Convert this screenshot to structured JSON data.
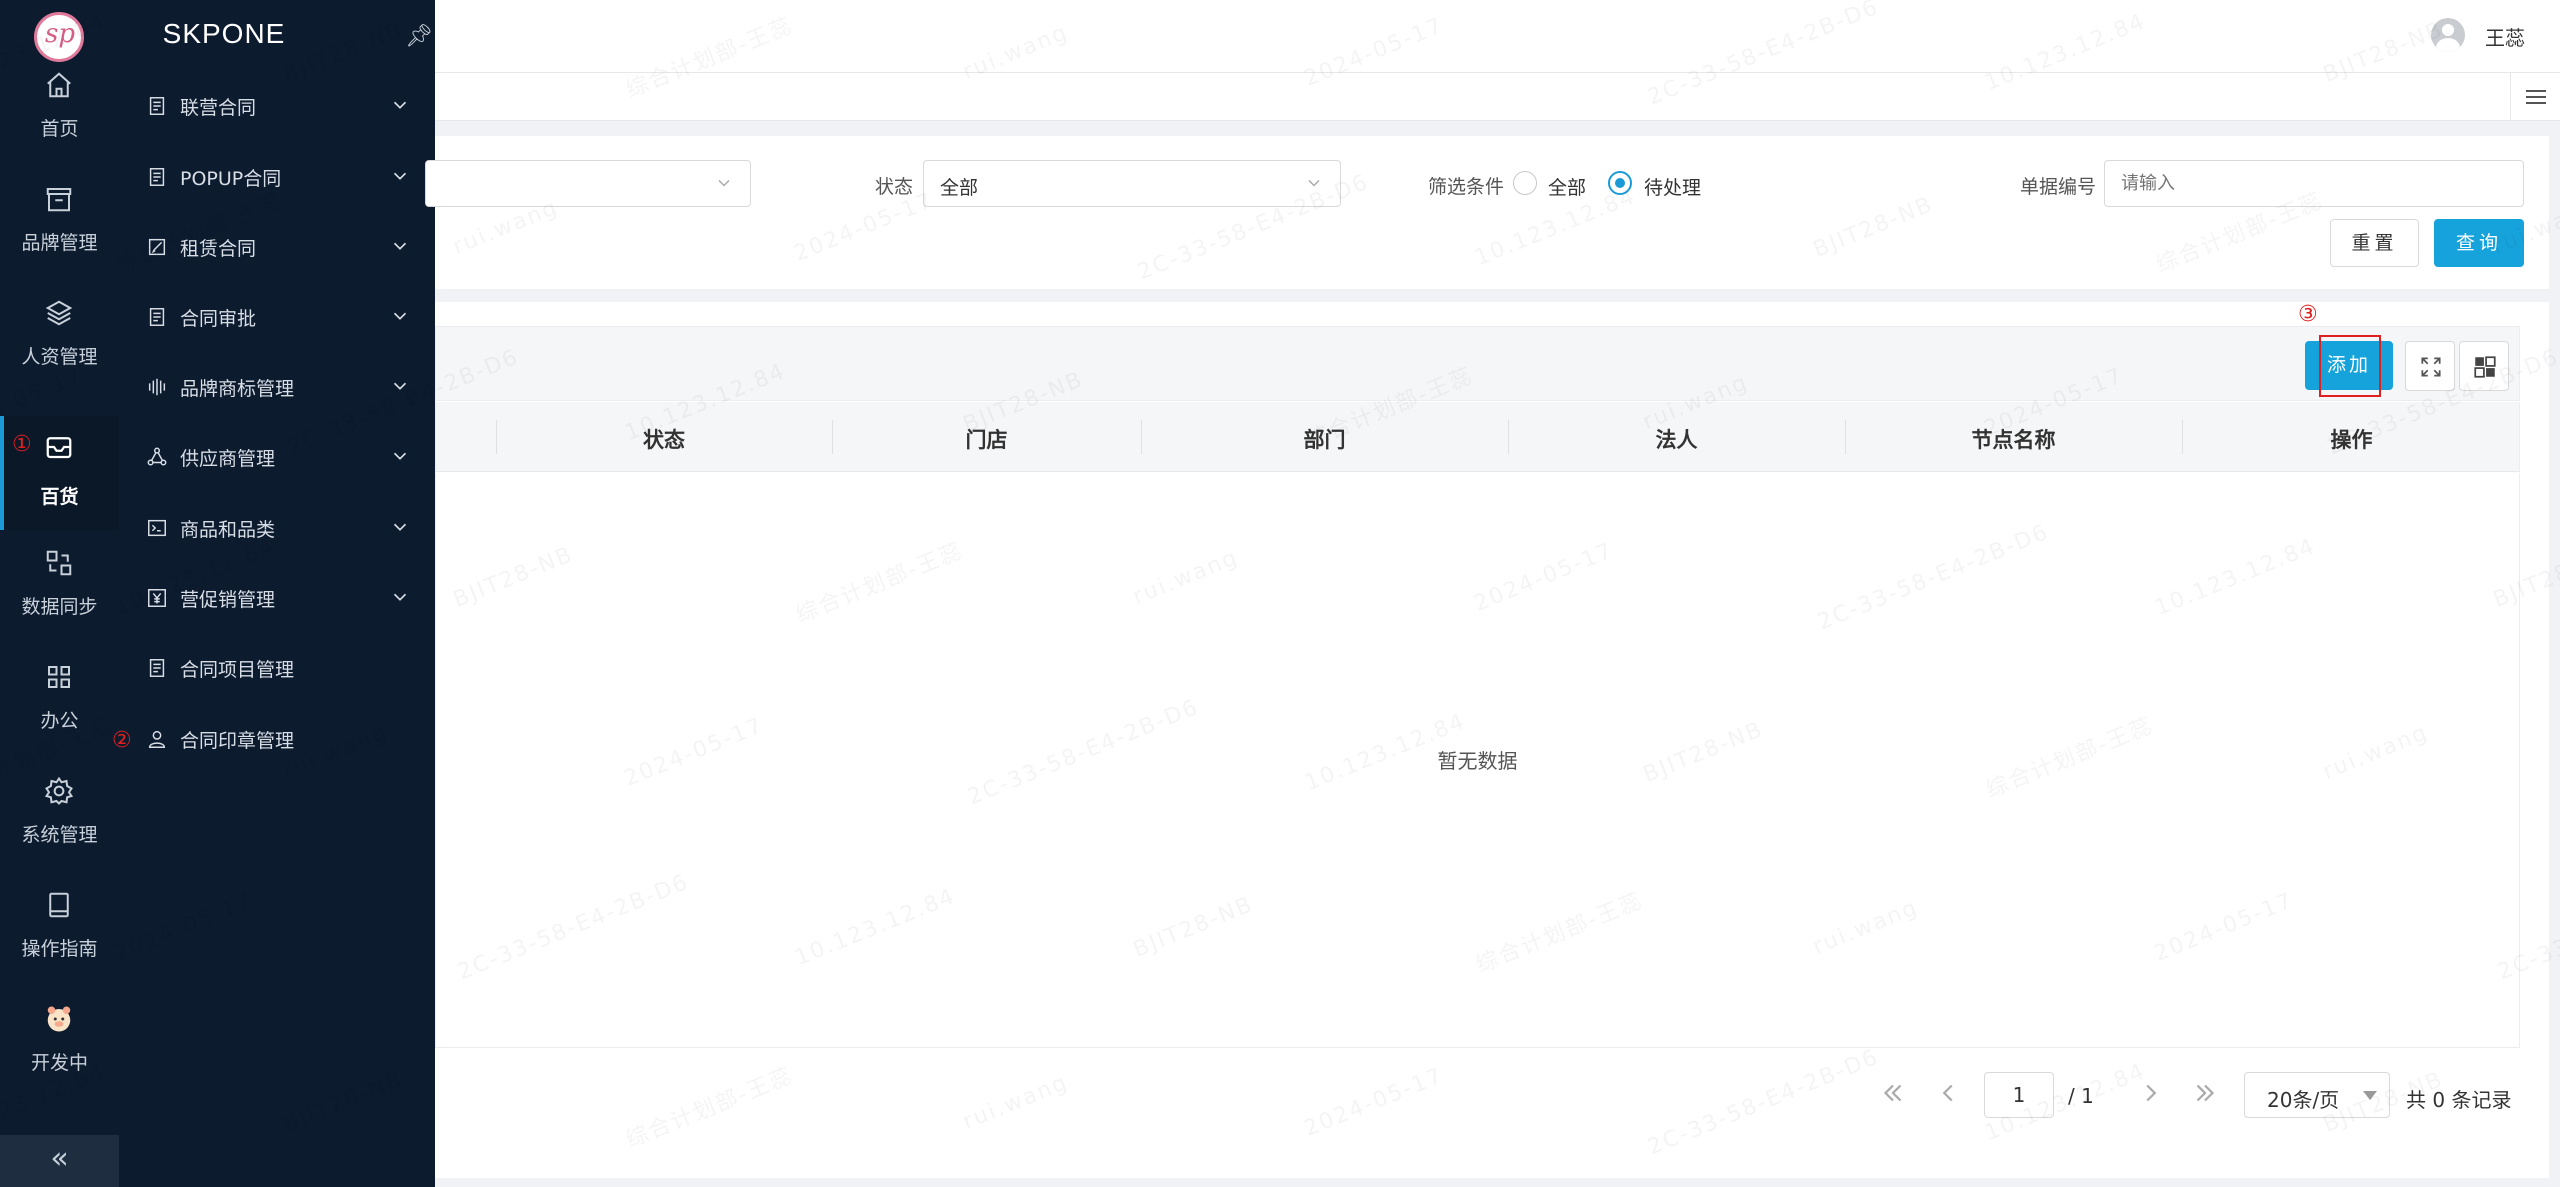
{
  "app": {
    "brand": "SKPONE"
  },
  "rail": {
    "items": [
      {
        "label": "首页",
        "icon": "home-icon"
      },
      {
        "label": "品牌管理",
        "icon": "store-icon"
      },
      {
        "label": "人资管理",
        "icon": "layers-icon"
      },
      {
        "label": "百货",
        "icon": "mailbox-icon",
        "active": true
      },
      {
        "label": "数据同步",
        "icon": "sync-icon"
      },
      {
        "label": "办公",
        "icon": "grid-icon"
      },
      {
        "label": "系统管理",
        "icon": "gear-icon"
      },
      {
        "label": "操作指南",
        "icon": "book-icon"
      },
      {
        "label": "开发中",
        "icon": "pig-icon"
      }
    ],
    "collapse": "«"
  },
  "submenu": {
    "items": [
      {
        "label": "联营合同",
        "icon": "document-icon",
        "expandable": true
      },
      {
        "label": "POPUP合同",
        "icon": "document-icon",
        "expandable": true
      },
      {
        "label": "租赁合同",
        "icon": "edit-document-icon",
        "expandable": true
      },
      {
        "label": "合同审批",
        "icon": "document-icon",
        "expandable": true
      },
      {
        "label": "品牌商标管理",
        "icon": "trademark-icon",
        "expandable": true
      },
      {
        "label": "供应商管理",
        "icon": "network-icon",
        "expandable": true
      },
      {
        "label": "商品和品类",
        "icon": "terminal-icon",
        "expandable": true
      },
      {
        "label": "营促销管理",
        "icon": "yen-icon",
        "expandable": true
      },
      {
        "label": "合同项目管理",
        "icon": "document-icon",
        "expandable": false
      },
      {
        "label": "合同印章管理",
        "icon": "user-icon",
        "expandable": false
      }
    ]
  },
  "header": {
    "user_name": "王蕊"
  },
  "annotations": {
    "step1": "①",
    "step2": "②",
    "step3": "③"
  },
  "filter": {
    "status_label": "状态",
    "status_value": "全部",
    "condition_label": "筛选条件",
    "condition_options": [
      "全部",
      "待处理"
    ],
    "condition_selected": "待处理",
    "doc_no_label": "单据编号",
    "doc_no_placeholder": "请输入",
    "reset_button": "重置",
    "query_button": "查询"
  },
  "table": {
    "add_button": "添加",
    "columns": [
      "状态",
      "门店",
      "部门",
      "法人",
      "节点名称",
      "操作"
    ],
    "rows": [],
    "empty_text": "暂无数据"
  },
  "pagination": {
    "current_page": "1",
    "total_pages": "/ 1",
    "page_size": "20条/页",
    "total_records": "共 0 条记录"
  },
  "watermark": {
    "lines": [
      "10.123.12.84",
      "BJIT28-NB",
      "综合计划部-王蕊",
      "rui.wang",
      "2024-05-17",
      "2C-33-58-E4-2B-D6"
    ]
  },
  "colors": {
    "sidebar_bg": "#0d1b2f",
    "primary": "#16a3db",
    "annotation_red": "#e02020",
    "page_bg": "#f0f2f5"
  }
}
